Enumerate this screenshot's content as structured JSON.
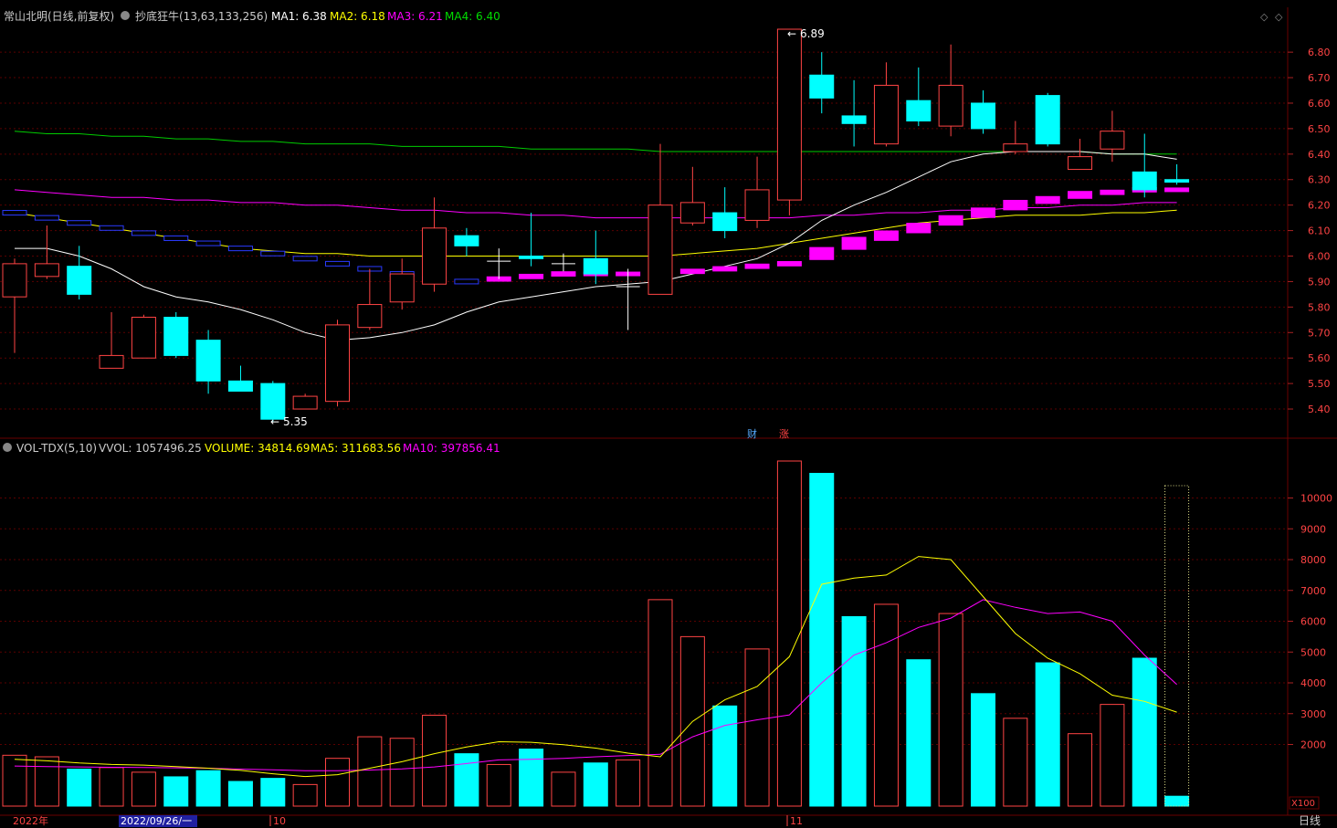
{
  "main_header": {
    "stock": "常山北明(日线,前复权)",
    "indicator": "抄底狂牛(13,63,133,256)",
    "ma1": "MA1: 6.38",
    "ma2": "MA2: 6.18",
    "ma3": "MA3: 6.21",
    "ma4": "MA4: 6.40"
  },
  "vol_header": {
    "name": "VOL-TDX(5,10)",
    "vvol": "VVOL: 1057496.25",
    "volume": "VOLUME: 34814.69",
    "ma5": "MA5: 311683.56",
    "ma10": "MA10: 397856.41"
  },
  "annotations": {
    "high": "6.89",
    "low": "5.35",
    "cai": "财",
    "zhang": "涨"
  },
  "bottom_axis": {
    "year": "2022年",
    "date_box": "2022/09/26/一",
    "m10": "10",
    "m11": "11",
    "period": "日线",
    "unit": "X100"
  },
  "colors": {
    "up": "#ff4444",
    "down": "#00ffff",
    "ma_white": "#ffffff",
    "ma_yellow": "#ffff00",
    "ma_magenta": "#ff00ff",
    "ma_green": "#00cc00",
    "grid": "#5a0000"
  },
  "chart_data": [
    {
      "type": "candlestick",
      "y_axis_labels": [
        "6.80",
        "6.70",
        "6.60",
        "6.50",
        "6.40",
        "6.30",
        "6.20",
        "6.10",
        "6.00",
        "5.90",
        "5.80",
        "5.70",
        "5.60",
        "5.50",
        "5.40"
      ],
      "ylim": [
        5.35,
        6.89
      ],
      "candles": [
        {
          "o": 5.84,
          "c": 5.97,
          "h": 5.99,
          "l": 5.62
        },
        {
          "o": 5.92,
          "c": 5.97,
          "h": 6.12,
          "l": 5.91
        },
        {
          "o": 5.96,
          "c": 5.85,
          "h": 6.04,
          "l": 5.83
        },
        {
          "o": 5.56,
          "c": 5.61,
          "h": 5.78,
          "l": 5.56
        },
        {
          "o": 5.6,
          "c": 5.76,
          "h": 5.77,
          "l": 5.6
        },
        {
          "o": 5.76,
          "c": 5.61,
          "h": 5.78,
          "l": 5.6
        },
        {
          "o": 5.67,
          "c": 5.51,
          "h": 5.71,
          "l": 5.46
        },
        {
          "o": 5.51,
          "c": 5.47,
          "h": 5.57,
          "l": 5.47
        },
        {
          "o": 5.5,
          "c": 5.36,
          "h": 5.51,
          "l": 5.35
        },
        {
          "o": 5.4,
          "c": 5.45,
          "h": 5.46,
          "l": 5.4
        },
        {
          "o": 5.43,
          "c": 5.73,
          "h": 5.75,
          "l": 5.41
        },
        {
          "o": 5.72,
          "c": 5.81,
          "h": 5.95,
          "l": 5.71
        },
        {
          "o": 5.82,
          "c": 5.93,
          "h": 5.99,
          "l": 5.79
        },
        {
          "o": 5.89,
          "c": 6.11,
          "h": 6.23,
          "l": 5.86
        },
        {
          "o": 6.08,
          "c": 6.04,
          "h": 6.11,
          "l": 6.0
        },
        {
          "o": 5.98,
          "c": 5.98,
          "h": 6.03,
          "l": 5.91
        },
        {
          "o": 6.0,
          "c": 5.99,
          "h": 6.17,
          "l": 5.96
        },
        {
          "o": 5.97,
          "c": 5.97,
          "h": 6.01,
          "l": 5.94
        },
        {
          "o": 5.99,
          "c": 5.93,
          "h": 6.1,
          "l": 5.89
        },
        {
          "o": 5.88,
          "c": 5.88,
          "h": 5.95,
          "l": 5.71
        },
        {
          "o": 5.85,
          "c": 6.2,
          "h": 6.44,
          "l": 5.85
        },
        {
          "o": 6.13,
          "c": 6.21,
          "h": 6.35,
          "l": 6.12
        },
        {
          "o": 6.17,
          "c": 6.1,
          "h": 6.27,
          "l": 6.07
        },
        {
          "o": 6.14,
          "c": 6.26,
          "h": 6.39,
          "l": 6.11
        },
        {
          "o": 6.22,
          "c": 6.89,
          "h": 6.89,
          "l": 6.16
        },
        {
          "o": 6.71,
          "c": 6.62,
          "h": 6.8,
          "l": 6.56
        },
        {
          "o": 6.55,
          "c": 6.52,
          "h": 6.69,
          "l": 6.43
        },
        {
          "o": 6.44,
          "c": 6.67,
          "h": 6.76,
          "l": 6.43
        },
        {
          "o": 6.61,
          "c": 6.53,
          "h": 6.74,
          "l": 6.51
        },
        {
          "o": 6.51,
          "c": 6.67,
          "h": 6.83,
          "l": 6.47
        },
        {
          "o": 6.6,
          "c": 6.5,
          "h": 6.65,
          "l": 6.48
        },
        {
          "o": 6.41,
          "c": 6.44,
          "h": 6.53,
          "l": 6.4
        },
        {
          "o": 6.63,
          "c": 6.44,
          "h": 6.64,
          "l": 6.43
        },
        {
          "o": 6.34,
          "c": 6.39,
          "h": 6.46,
          "l": 6.34
        },
        {
          "o": 6.42,
          "c": 6.49,
          "h": 6.57,
          "l": 6.37
        },
        {
          "o": 6.33,
          "c": 6.26,
          "h": 6.48,
          "l": 6.23
        },
        {
          "o": 6.3,
          "c": 6.29,
          "h": 6.36,
          "l": 6.28
        }
      ],
      "ma1": [
        6.03,
        6.03,
        6.0,
        5.95,
        5.88,
        5.84,
        5.82,
        5.79,
        5.75,
        5.7,
        5.67,
        5.68,
        5.7,
        5.73,
        5.78,
        5.82,
        5.84,
        5.86,
        5.88,
        5.89,
        5.9,
        5.93,
        5.96,
        5.99,
        6.05,
        6.14,
        6.2,
        6.25,
        6.31,
        6.37,
        6.4,
        6.41,
        6.41,
        6.41,
        6.4,
        6.4,
        6.38
      ],
      "ma2": [
        6.17,
        6.15,
        6.13,
        6.11,
        6.09,
        6.07,
        6.05,
        6.03,
        6.02,
        6.01,
        6.01,
        6.0,
        6.0,
        6.0,
        6.0,
        6.0,
        6.0,
        6.0,
        6.0,
        6.0,
        6.0,
        6.01,
        6.02,
        6.03,
        6.05,
        6.07,
        6.09,
        6.11,
        6.13,
        6.14,
        6.15,
        6.16,
        6.16,
        6.16,
        6.17,
        6.17,
        6.18
      ],
      "ma3": [
        6.26,
        6.25,
        6.24,
        6.23,
        6.23,
        6.22,
        6.22,
        6.21,
        6.21,
        6.2,
        6.2,
        6.19,
        6.18,
        6.18,
        6.17,
        6.17,
        6.16,
        6.16,
        6.15,
        6.15,
        6.15,
        6.15,
        6.15,
        6.15,
        6.15,
        6.16,
        6.16,
        6.17,
        6.17,
        6.18,
        6.18,
        6.19,
        6.19,
        6.2,
        6.2,
        6.21,
        6.21
      ],
      "ma4": [
        6.49,
        6.48,
        6.48,
        6.47,
        6.47,
        6.46,
        6.46,
        6.45,
        6.45,
        6.44,
        6.44,
        6.44,
        6.43,
        6.43,
        6.43,
        6.43,
        6.42,
        6.42,
        6.42,
        6.42,
        6.41,
        6.41,
        6.41,
        6.41,
        6.41,
        6.41,
        6.41,
        6.41,
        6.41,
        6.41,
        6.41,
        6.41,
        6.41,
        6.41,
        6.4,
        6.4,
        6.4
      ],
      "stair": [
        6.17,
        6.15,
        6.13,
        6.11,
        6.09,
        6.07,
        6.05,
        6.03,
        6.01,
        5.99,
        5.97,
        5.95,
        5.93,
        5.91,
        5.9,
        5.91,
        5.92,
        5.93,
        5.93,
        5.93,
        5.93,
        5.94,
        5.95,
        5.96,
        5.97,
        6.01,
        6.05,
        6.08,
        6.11,
        6.14,
        6.17,
        6.2,
        6.22,
        6.24,
        6.25,
        6.26,
        6.26
      ]
    },
    {
      "type": "bar",
      "y_axis_labels": [
        "10000",
        "9000",
        "8000",
        "7000",
        "6000",
        "5000",
        "4000",
        "3000",
        "2000"
      ],
      "ylim": [
        0,
        11200
      ],
      "volumes": [
        1650,
        1600,
        1200,
        1250,
        1100,
        950,
        1150,
        800,
        900,
        700,
        1550,
        2250,
        2200,
        2950,
        1700,
        1350,
        1850,
        1100,
        1400,
        1500,
        6700,
        5500,
        3250,
        5100,
        11200,
        10800,
        6150,
        6550,
        4750,
        6250,
        3650,
        2850,
        4650,
        2350,
        3300,
        4800,
        320
      ],
      "ma5": [
        1520,
        1470,
        1400,
        1350,
        1330,
        1280,
        1230,
        1160,
        1050,
        960,
        1020,
        1230,
        1440,
        1700,
        1920,
        2090,
        2070,
        1990,
        1880,
        1720,
        1600,
        2750,
        3450,
        3880,
        4850,
        7200,
        7400,
        7500,
        8100,
        8000,
        6800,
        5600,
        4800,
        4300,
        3600,
        3400,
        3050
      ],
      "ma10": [
        1300,
        1280,
        1270,
        1260,
        1250,
        1240,
        1230,
        1200,
        1180,
        1150,
        1150,
        1170,
        1210,
        1270,
        1380,
        1500,
        1520,
        1550,
        1600,
        1640,
        1680,
        2250,
        2620,
        2800,
        2960,
        4000,
        4900,
        5300,
        5800,
        6100,
        6700,
        6450,
        6250,
        6300,
        6000,
        4900,
        3950
      ]
    }
  ]
}
